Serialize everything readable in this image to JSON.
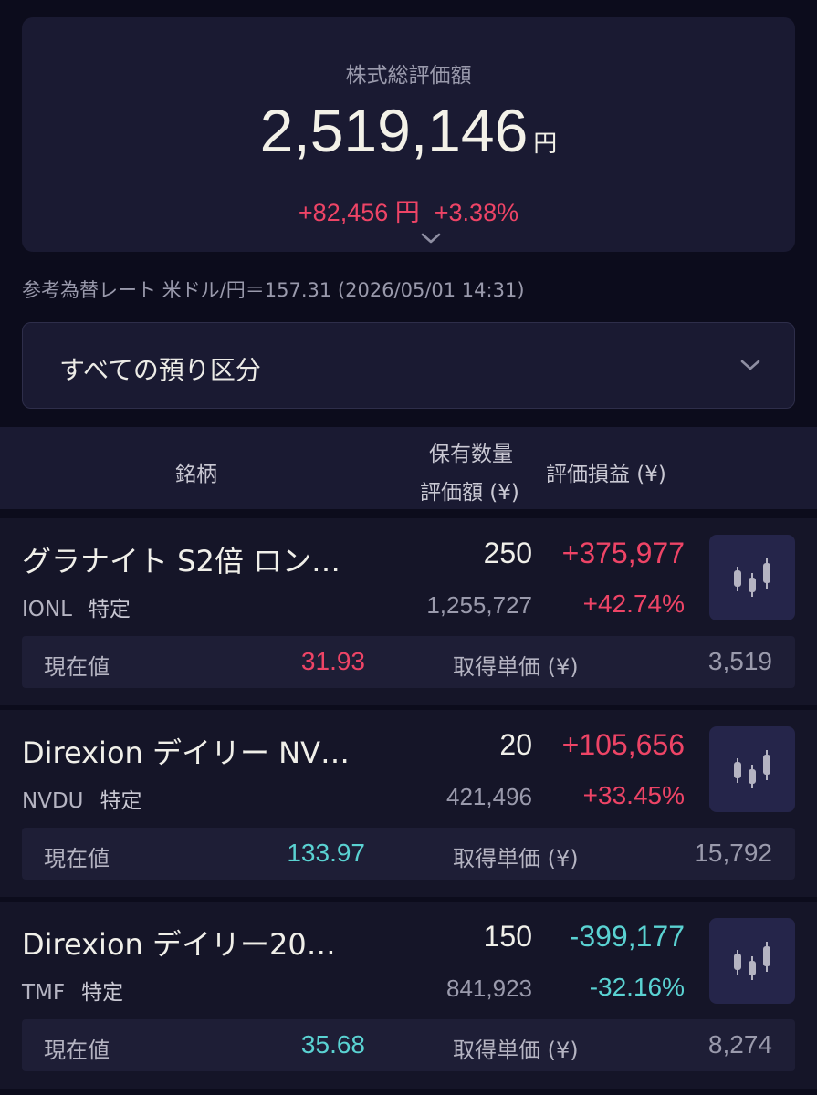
{
  "summary": {
    "title": "株式総評価額",
    "total_value": "2,519,146",
    "total_unit": "円",
    "change_amount": "+82,456 円",
    "change_percent": "+3.38%",
    "expand_icon": "chevron-down-icon"
  },
  "fx_rate": "参考為替レート 米ドル/円＝157.31 (2026/05/01 14:31)",
  "account_filter": {
    "selected": "すべての預り区分",
    "icon": "chevron-down-icon"
  },
  "table_header": {
    "name": "銘柄",
    "quantity": "保有数量",
    "valuation": "評価額 (¥)",
    "profit_loss": "評価損益 (¥)"
  },
  "colors": {
    "positive": "#ee4466",
    "negative": "#5ad2d2",
    "background": "#0c0c1c",
    "panel": "#1a1a32"
  },
  "holdings": [
    {
      "name": "グラナイト S2倍 ロン…",
      "code": "IONL",
      "account": "特定",
      "quantity": "250",
      "valuation": "1,255,727",
      "profit_loss": "+375,977",
      "profit_loss_percent": "+42.74%",
      "direction": "positive",
      "current_price_label": "現在値",
      "current_price": "31.93",
      "current_price_direction": "positive",
      "cost_label": "取得単価 (¥)",
      "cost": "3,519",
      "chart_icon": "candlestick-chart-icon"
    },
    {
      "name": "Direxion デイリー NV…",
      "code": "NVDU",
      "account": "特定",
      "quantity": "20",
      "valuation": "421,496",
      "profit_loss": "+105,656",
      "profit_loss_percent": "+33.45%",
      "direction": "positive",
      "current_price_label": "現在値",
      "current_price": "133.97",
      "current_price_direction": "negative",
      "cost_label": "取得単価 (¥)",
      "cost": "15,792",
      "chart_icon": "candlestick-chart-icon"
    },
    {
      "name": "Direxion デイリー20…",
      "code": "TMF",
      "account": "特定",
      "quantity": "150",
      "valuation": "841,923",
      "profit_loss": "-399,177",
      "profit_loss_percent": "-32.16%",
      "direction": "negative",
      "current_price_label": "現在値",
      "current_price": "35.68",
      "current_price_direction": "negative",
      "cost_label": "取得単価 (¥)",
      "cost": "8,274",
      "chart_icon": "candlestick-chart-icon"
    }
  ]
}
